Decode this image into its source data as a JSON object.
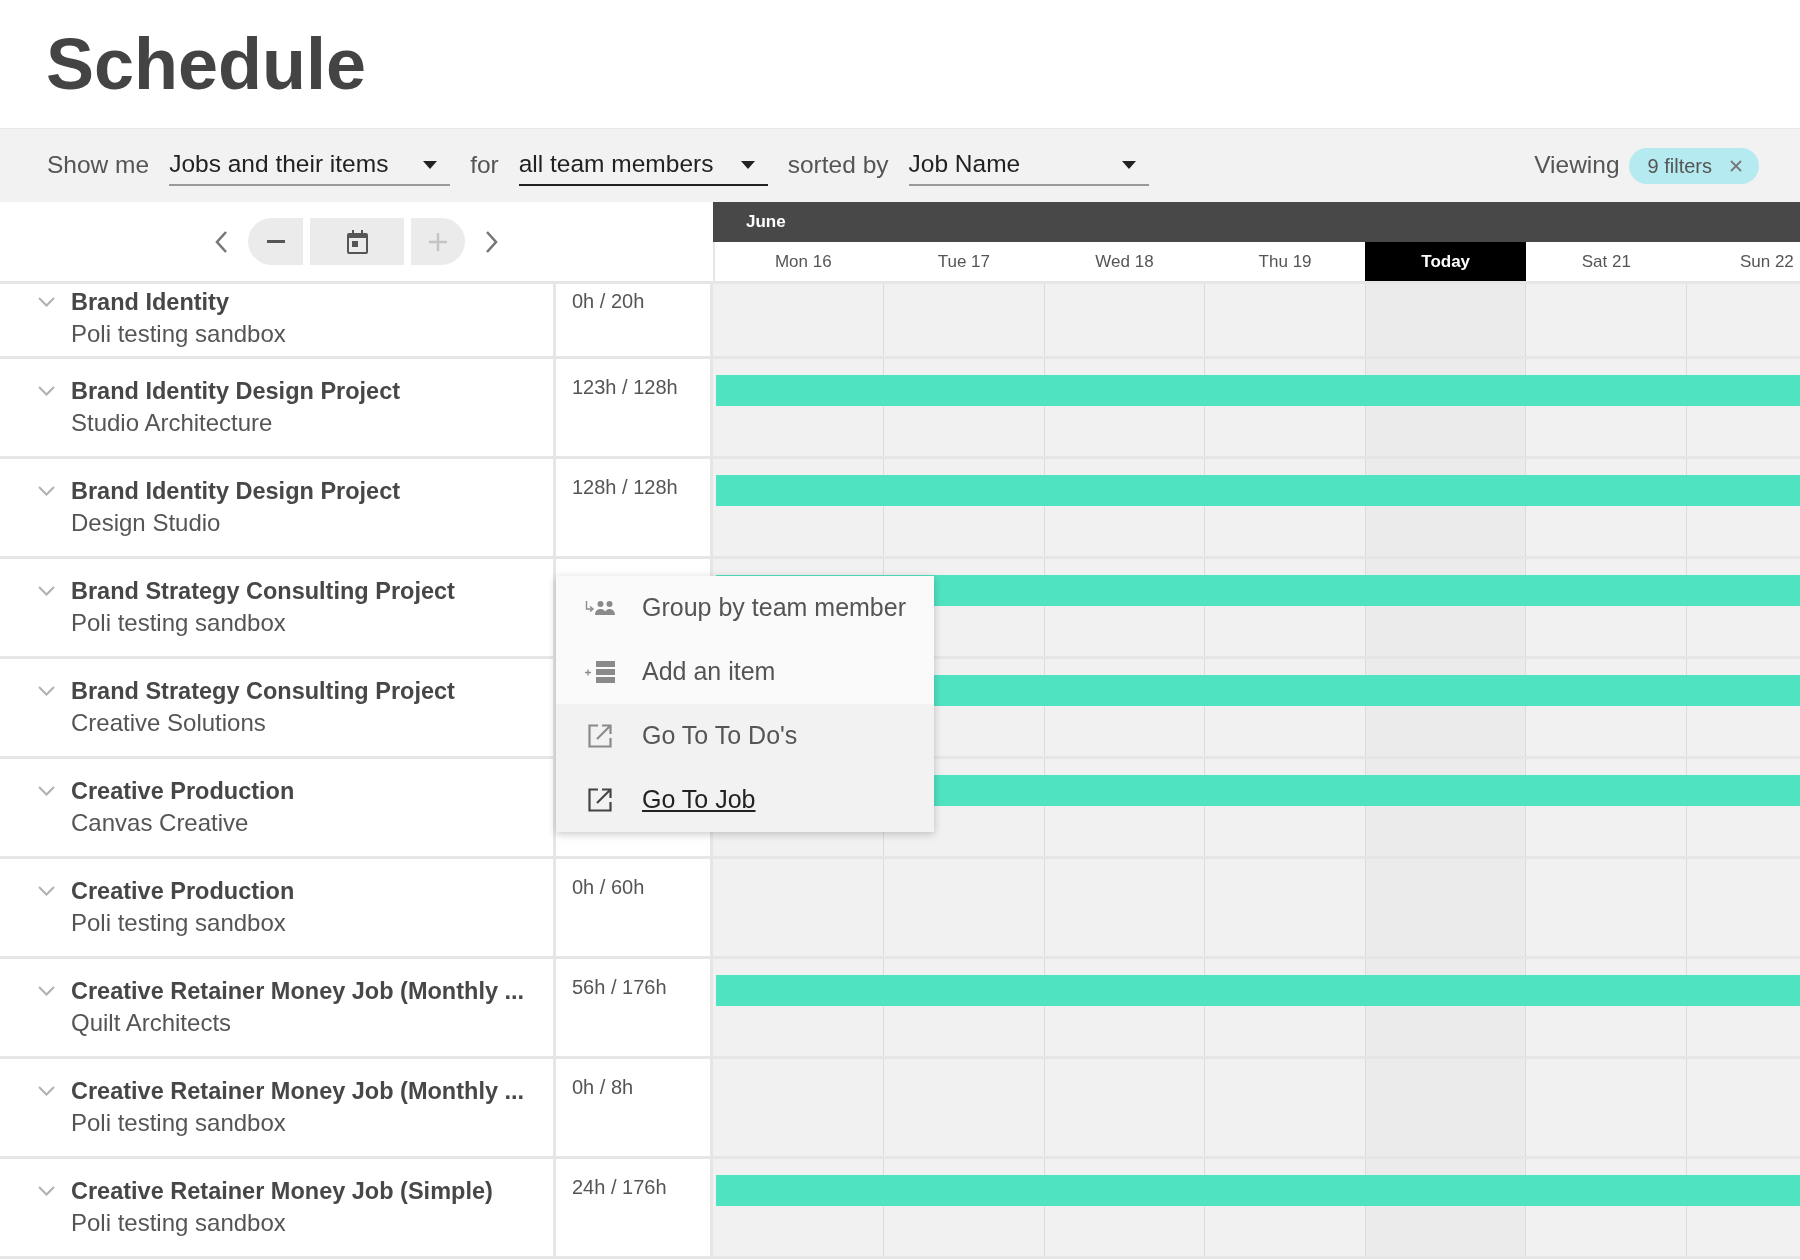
{
  "header": {
    "title": "Schedule"
  },
  "filter_bar": {
    "parts": [
      {
        "kind": "label",
        "text": "Show me"
      },
      {
        "kind": "dropdown",
        "value": "Jobs and their items",
        "focused": false
      },
      {
        "kind": "label",
        "text": "for"
      },
      {
        "kind": "dropdown",
        "value": "all team members",
        "focused": true
      },
      {
        "kind": "label",
        "text": "sorted by"
      },
      {
        "kind": "dropdown",
        "value": "Job Name",
        "focused": false
      }
    ],
    "viewing": {
      "label": "Viewing",
      "chip": "9 filters"
    }
  },
  "navigator": {
    "zoom_out": {
      "disabled": false
    },
    "zoom_in": {
      "disabled": true
    }
  },
  "calendar": {
    "month": "June",
    "days": [
      {
        "label": "Mon 16",
        "today": false
      },
      {
        "label": "Tue 17",
        "today": false
      },
      {
        "label": "Wed 18",
        "today": false
      },
      {
        "label": "Thu 19",
        "today": false
      },
      {
        "label": "Today",
        "today": true
      },
      {
        "label": "Sat 21",
        "today": false
      },
      {
        "label": "Sun 22",
        "today": false
      }
    ]
  },
  "rows": [
    {
      "title": "Brand Identity",
      "client": "Poli testing sandbox",
      "hours": "0h / 20h",
      "bar": false
    },
    {
      "title": "Brand Identity Design Project",
      "client": "Studio Architecture",
      "hours": "123h / 128h",
      "bar": true
    },
    {
      "title": "Brand Identity Design Project",
      "client": "Design Studio",
      "hours": "128h / 128h",
      "bar": true
    },
    {
      "title": "Brand Strategy Consulting Project",
      "client": "Poli testing sandbox",
      "bar": true
    },
    {
      "title": "Brand Strategy Consulting Project",
      "client": "Creative Solutions",
      "bar": true
    },
    {
      "title": "Creative Production",
      "client": "Canvas Creative",
      "bar": true
    },
    {
      "title": "Creative Production",
      "client": "Poli testing sandbox",
      "hours": "0h / 60h",
      "bar": false
    },
    {
      "title": "Creative Retainer Money Job (Monthly ...",
      "client": "Quilt Architects",
      "hours": "56h / 176h",
      "bar": true
    },
    {
      "title": "Creative Retainer Money Job (Monthly ...",
      "client": "Poli testing sandbox",
      "hours": "0h / 8h",
      "bar": false
    },
    {
      "title": "Creative Retainer Money Job (Simple)",
      "client": "Poli testing sandbox",
      "hours": "24h / 176h",
      "bar": true
    }
  ],
  "context_menu": {
    "items": [
      {
        "kind": "group",
        "label": "Group by team member",
        "hovered": false
      },
      {
        "kind": "add",
        "label": "Add an item",
        "hovered": false
      },
      {
        "kind": "link",
        "label": "Go To To Do's",
        "hovered": false
      },
      {
        "kind": "link",
        "label": "Go To Job",
        "hovered": true
      }
    ]
  }
}
